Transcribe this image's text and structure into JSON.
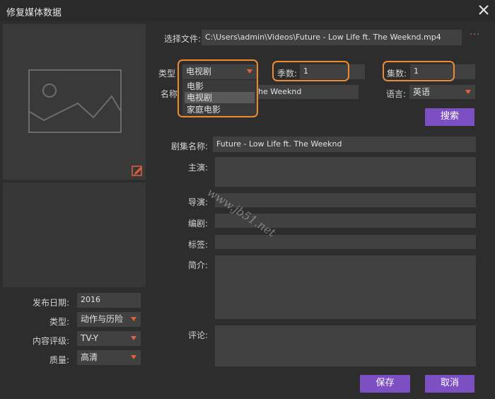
{
  "window": {
    "title": "修复媒体数据",
    "close_icon": "close-icon"
  },
  "file": {
    "label": "选择文件:",
    "path": "C:\\Users\\admin\\Videos\\Future - Low Life ft. The Weeknd.mp4",
    "browse": "···"
  },
  "type": {
    "label": "类型",
    "selected": "电视剧",
    "options": [
      "电影",
      "电视剧",
      "家庭电影"
    ],
    "highlighted_index": 1
  },
  "season": {
    "label": "季数:",
    "value": "1"
  },
  "episode": {
    "label": "集数:",
    "value": "1"
  },
  "name": {
    "label": "名称",
    "value": "he Weeknd"
  },
  "language": {
    "label": "语言:",
    "value": "英语"
  },
  "search_button": "搜索",
  "details": {
    "series_name_label": "剧集名称:",
    "series_name_value": "Future - Low Life ft. The Weeknd",
    "cast_label": "主演:",
    "director_label": "导演:",
    "writer_label": "编剧:",
    "tags_label": "标签:",
    "summary_label": "简介:",
    "comment_label": "评论:"
  },
  "left_meta": {
    "release_label": "发布日期:",
    "release_value": "2016",
    "genre_label": "类型:",
    "genre_value": "动作与历险",
    "rating_label": "内容评级:",
    "rating_value": "TV-Y",
    "quality_label": "质量:",
    "quality_value": "高清"
  },
  "buttons": {
    "save": "保存",
    "cancel": "取消"
  },
  "watermark": "www.jb51.net",
  "colors": {
    "accent": "#7c4fc3",
    "highlight": "#f08a2e",
    "dropdown_arrow": "#e4613b"
  }
}
